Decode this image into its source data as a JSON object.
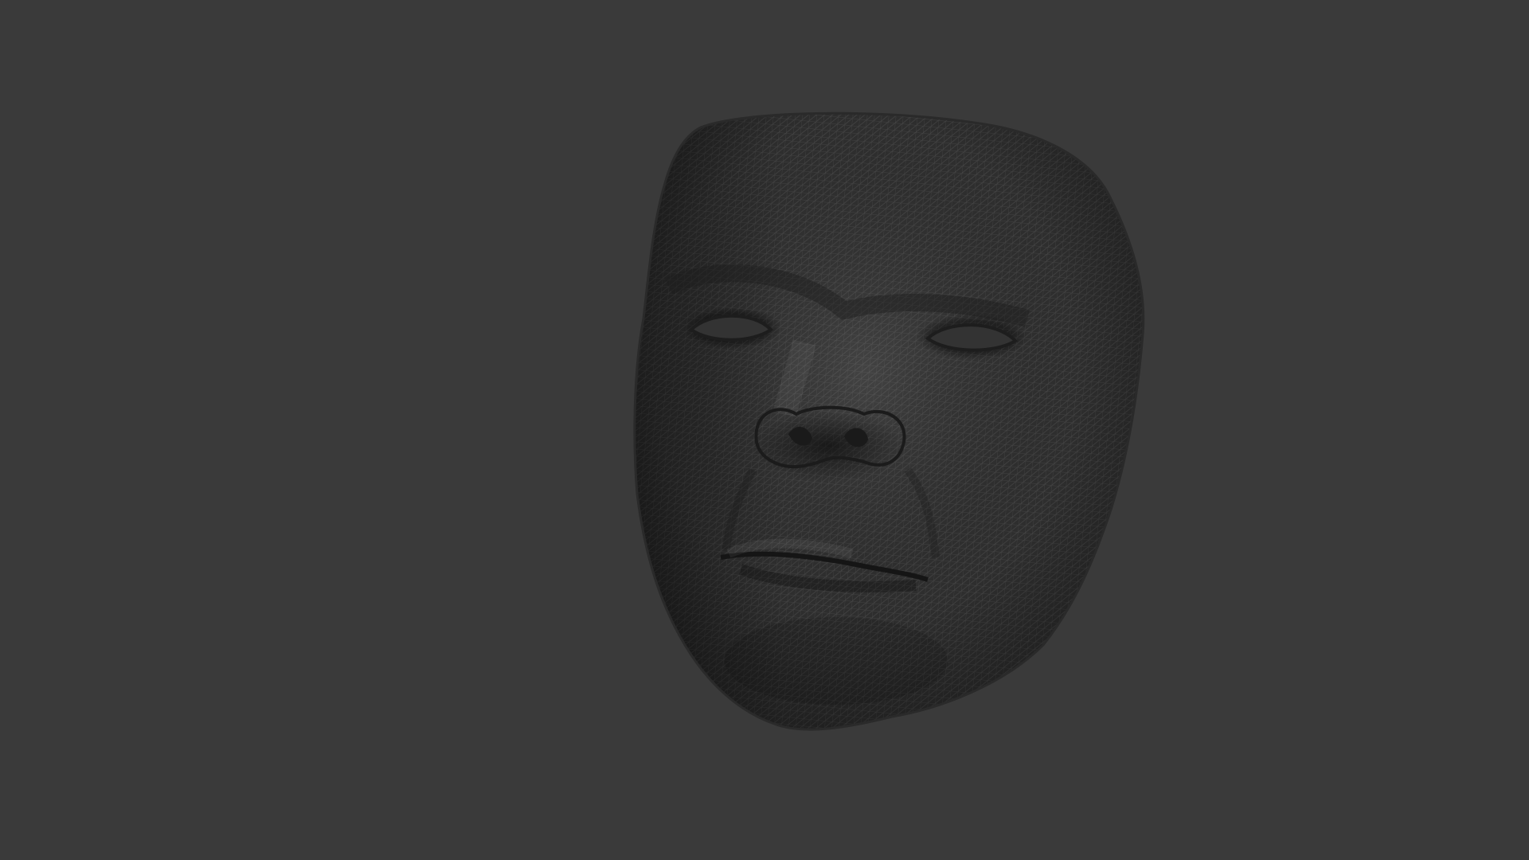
{
  "viewport": {
    "background_color": "#3a3a3a",
    "mesh_base_color": "#2f2f2f",
    "mesh_wire_color": "#4a4a4a",
    "mesh_shadow_color": "#1f1f1f",
    "render_mode": "wireframe-on-shaded"
  }
}
